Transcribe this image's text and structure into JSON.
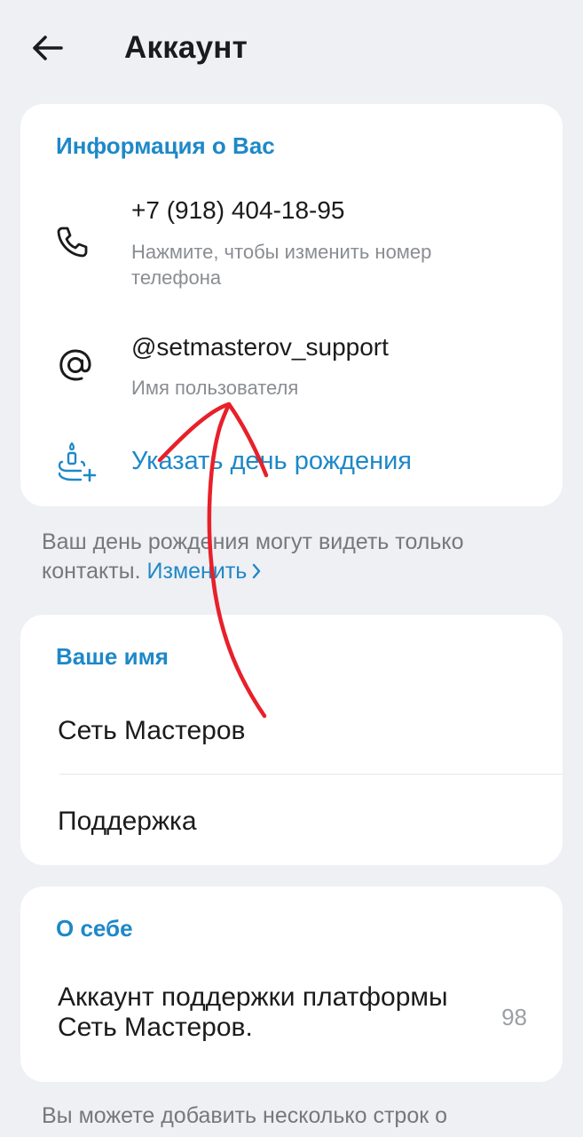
{
  "header": {
    "title": "Аккаунт",
    "back_icon": "arrow-left-icon"
  },
  "info_card": {
    "header": "Информация о Вас",
    "phone": {
      "icon": "phone-icon",
      "value": "+7 (918) 404-18-95",
      "hint": "Нажмите, чтобы изменить номер телефона"
    },
    "username": {
      "icon": "at-sign-icon",
      "value": "@setmasterov_support",
      "hint": "Имя пользователя"
    },
    "birthday": {
      "icon": "cake-plus-icon",
      "label": "Указать день рождения"
    }
  },
  "birthday_hint": {
    "text": "Ваш день рождения могут видеть только контакты. ",
    "link": "Изменить",
    "link_icon": "chevron-right-icon"
  },
  "name_card": {
    "header": "Ваше имя",
    "first_name": "Сеть Мастеров",
    "last_name": "Поддержка"
  },
  "about_card": {
    "header": "О себе",
    "bio": "Аккаунт поддержки платформы Сеть Мастеров.",
    "counter": "98"
  },
  "about_hint": {
    "text": "Вы можете добавить несколько строк о"
  },
  "colors": {
    "background": "#eff0f3",
    "card": "#ffffff",
    "accent": "#1e88c8",
    "annotation": "#e8202a"
  }
}
